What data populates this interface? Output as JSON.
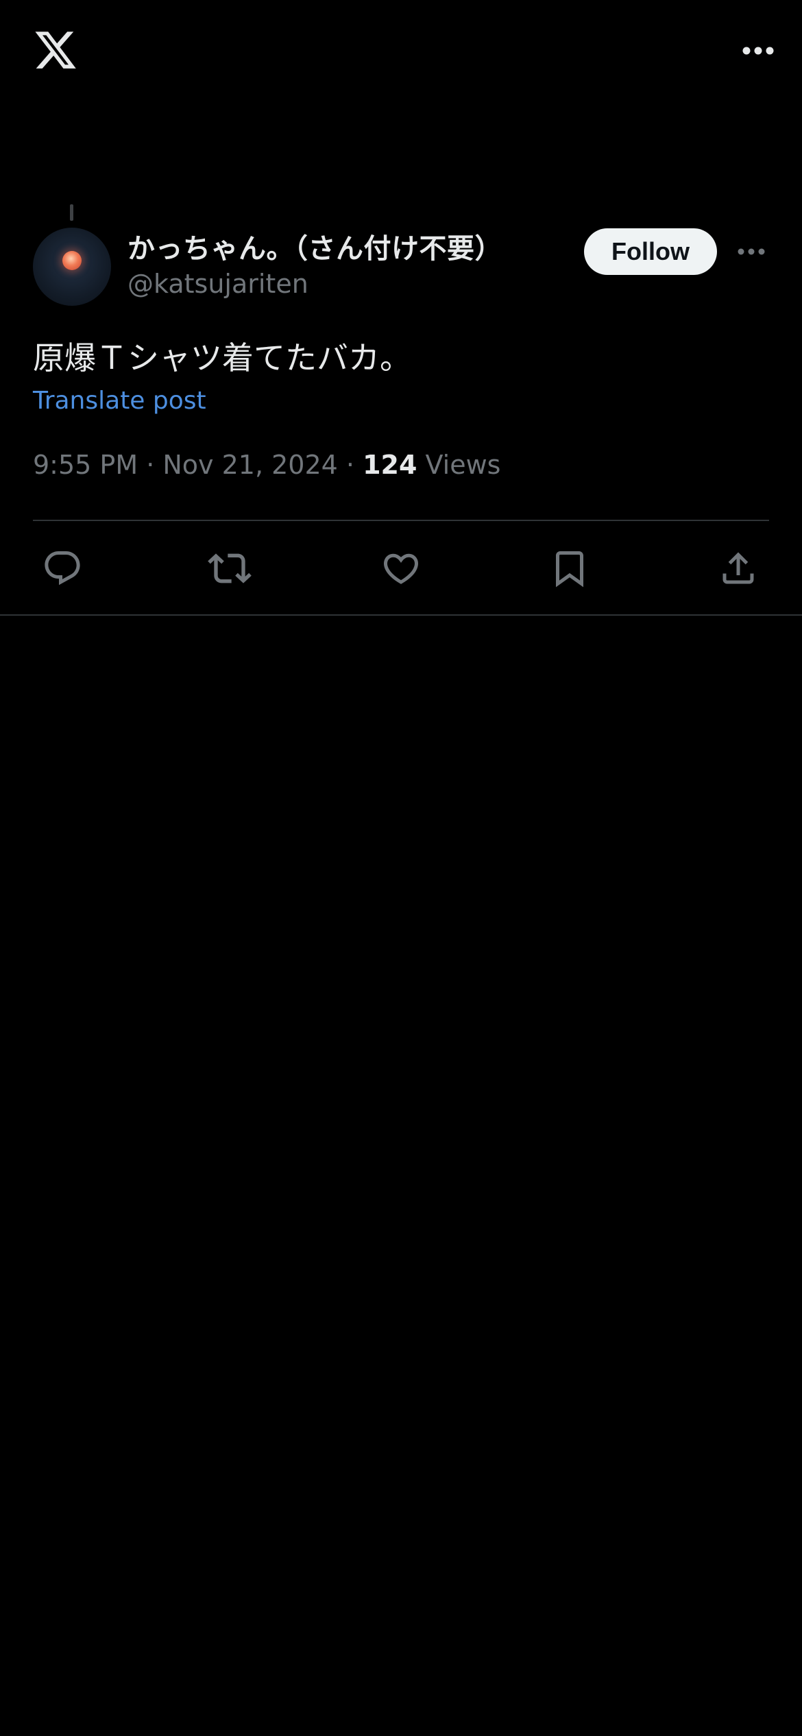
{
  "header": {
    "logo_icon": "x-logo-icon",
    "more_icon": "more-horizontal-icon"
  },
  "post": {
    "author": {
      "display_name": "かっちゃん。（さん付け不要）",
      "handle": "@katsujariten",
      "avatar_icon": "avatar"
    },
    "follow_label": "Follow",
    "more_icon": "more-horizontal-icon",
    "text": "原爆Ｔシャツ着てたバカ。",
    "translate_label": "Translate post",
    "timestamp": "9:55 PM · Nov 21, 2024 · ",
    "views_count": "124",
    "views_label": " Views"
  },
  "actions": {
    "reply_icon": "reply-icon",
    "repost_icon": "repost-icon",
    "like_icon": "heart-icon",
    "bookmark_icon": "bookmark-icon",
    "share_icon": "share-icon"
  },
  "colors": {
    "background": "#000000",
    "text_primary": "#e7e9ea",
    "text_secondary": "#71767b",
    "link": "#4d8fe0",
    "divider": "#2f3336",
    "follow_bg": "#eff3f4"
  }
}
